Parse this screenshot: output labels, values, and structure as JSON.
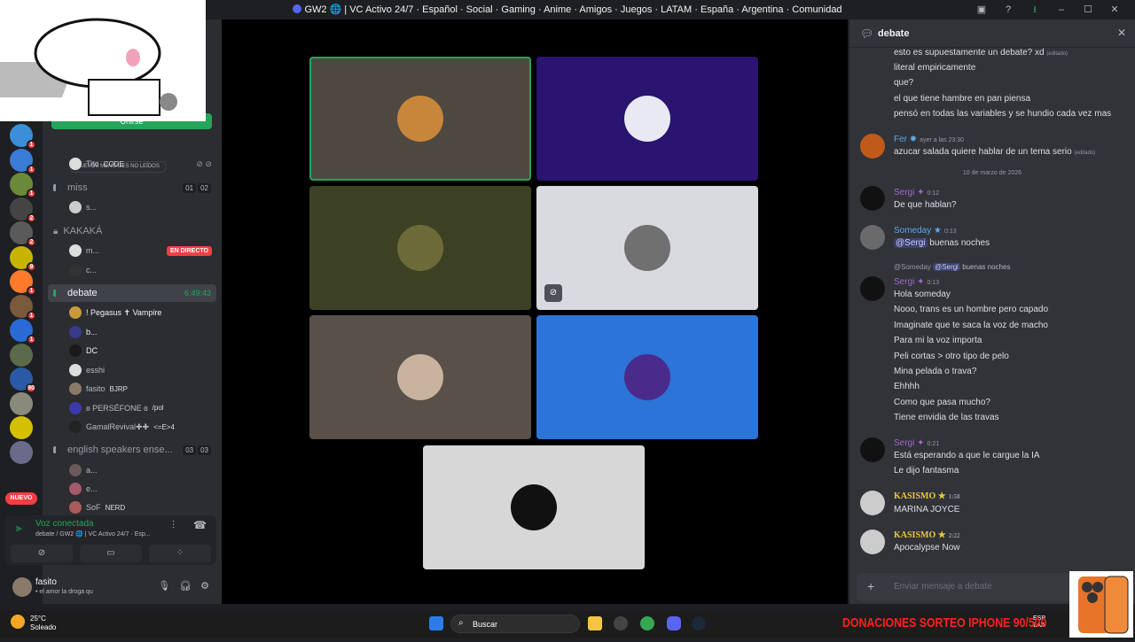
{
  "window": {
    "title": "GW2 🌐 | VC Activo 24/7 · Español · Social · Gaming · Anime · Amigos · Juegos · LATAM · España · Argentina · Comunidad"
  },
  "servers": [
    {
      "badge": "1",
      "color": "#3b8fd9"
    },
    {
      "badge": "1",
      "color": "#3a7bd5"
    },
    {
      "badge": "1",
      "color": "#6a8a3a"
    },
    {
      "badge": "2",
      "color": "#444444"
    },
    {
      "badge": "2",
      "color": "#5a5a5a"
    },
    {
      "badge": "9",
      "color": "#c8b400"
    },
    {
      "badge": "1",
      "color": "#ff7a2a"
    },
    {
      "badge": "1",
      "color": "#7a5a3a"
    },
    {
      "badge": "1",
      "color": "#2a6ad5"
    },
    {
      "badge": "",
      "color": "#5a6a4a"
    },
    {
      "badge": "90",
      "color": "#2a5aa5"
    },
    {
      "badge": "",
      "color": "#8a8a7a"
    },
    {
      "badge": "",
      "color": "#d4c000"
    },
    {
      "badge": "",
      "color": "#6a6a8a"
    }
  ],
  "sidebar": {
    "new_label": "NUEVO",
    "join_label": "Unirse",
    "unread_banner": "NUEVOS MENSAJES NO LEÍDOS",
    "channels": {
      "tito": {
        "name": "Tito",
        "tag": "CODE"
      },
      "miss": {
        "name": "miss",
        "c1": "01",
        "c2": "02",
        "member": "s..."
      },
      "kakaka": {
        "name": "KAKAKÁ",
        "m1": "m...",
        "live": "EN DIRECTO",
        "m2": "c..."
      },
      "debate": {
        "name": "debate",
        "timer": "6:49:43"
      },
      "english": {
        "name": "english speakers ense...",
        "c1": "03",
        "c2": "03"
      }
    },
    "debate_members": [
      {
        "name": "! Pegasus ✝ Vampire",
        "tag": "",
        "color": "#c89a3a"
      },
      {
        "name": "b...",
        "tag": "",
        "color": "#3a3a8a"
      },
      {
        "name": "DC",
        "tag": "",
        "color": "#1a1a1a"
      },
      {
        "name": "esshi",
        "tag": "",
        "color": "#dddddd"
      },
      {
        "name": "fasito",
        "tag": "BJRP",
        "color": "#8a7a6a"
      },
      {
        "name": "ʚ PERSÉFONE ɞ",
        "tag": "/pol",
        "color": "#3a3aaa"
      },
      {
        "name": "GamalRevival✚✚",
        "tag": "<=E>4",
        "color": "#222222"
      }
    ],
    "english_members": [
      {
        "name": "a...",
        "color": "#6a5a5a"
      },
      {
        "name": "e...",
        "color": "#a55a6a"
      },
      {
        "name": "SoF",
        "tag": "NERD",
        "color": "#aa5a5a"
      }
    ]
  },
  "voice_panel": {
    "status": "Voz conectada",
    "sub": "debate / GW2 🌐 | VC Activo 24/7 · Esp..."
  },
  "user": {
    "name": "fasito",
    "status": "• el amor la droga qu"
  },
  "stage_tiles": [
    {
      "bg": "#4f4841",
      "face": "#c8863a",
      "speaking": true,
      "muted": false
    },
    {
      "bg": "#2b1470",
      "face": "#e9e9f4",
      "speaking": false,
      "muted": false
    },
    {
      "bg": "#3d4124",
      "face": "#6d6a3a",
      "speaking": false,
      "muted": false
    },
    {
      "bg": "#d9dadf",
      "face": "#707070",
      "speaking": false,
      "muted": true
    },
    {
      "bg": "#59504a",
      "face": "#c9b39e",
      "speaking": false,
      "muted": false
    },
    {
      "bg": "#2c74d7",
      "face": "#4a2a8a",
      "speaking": false,
      "muted": false
    },
    {
      "bg": "#d7d7d7",
      "face": "#111111",
      "speaking": false,
      "muted": false
    }
  ],
  "chat": {
    "channel": "debate",
    "edited": "(editado)",
    "messages_top": [
      "esto es supuestamente un debate? xd",
      "literal empiricamente",
      "que?",
      "el que tiene hambre en pan piensa",
      "pensó en todas las variables y se hundio cada vez mas"
    ],
    "fer": {
      "author": "Fer",
      "time": "ayer a las 23:30",
      "text": "azucar salada quiere hablar de un tema serio"
    },
    "date_sep": "10 de marzo de 2026",
    "sergi1": {
      "author": "Sergi",
      "time": "0:12",
      "text": "De que hablan?"
    },
    "someday": {
      "author": "Someday",
      "time": "0:13",
      "mention": "@Sergi",
      "text": "buenas noches"
    },
    "reply": {
      "who": "@Someday",
      "mention": "@Sergi",
      "text": "buenas noches"
    },
    "sergi2": {
      "author": "Sergi",
      "time": "0:13",
      "lines": [
        "Hola someday",
        "Nooo, trans es un hombre pero capado",
        "Imaginate que te saca la voz de macho",
        "Para mi la voz importa",
        "Peli cortas > otro tipo de pelo",
        "Mina pelada o trava?",
        "Ehhhh",
        "Como que pasa mucho?",
        "Tiene envidia de las travas"
      ]
    },
    "sergi3": {
      "author": "Sergi",
      "time": "0:21",
      "lines": [
        "Está esperando a que le cargue la IA",
        "Le dijo fantasma"
      ]
    },
    "kasismo1": {
      "author": "KASISMO",
      "time": "1:58",
      "text": "MARINA JOYCE"
    },
    "kasismo2": {
      "author": "KASISMO",
      "time": "2:22",
      "text": "Apocalypse Now"
    },
    "compose_placeholder": "Enviar mensaje a debate"
  },
  "taskbar": {
    "temp": "25°C",
    "weather": "Soleado",
    "search": "Buscar",
    "lang1": "ESP",
    "lang2": "LAA"
  },
  "overlay": {
    "donations": "DONACIONES SORTEO IPHONE 90/500"
  },
  "colors": {
    "green": "#23a55a",
    "red": "#f23f43",
    "blurple": "#5865f2",
    "sergi": "#a267d6",
    "someday": "#5fa8e8",
    "kasismo": "#e8c93a"
  }
}
